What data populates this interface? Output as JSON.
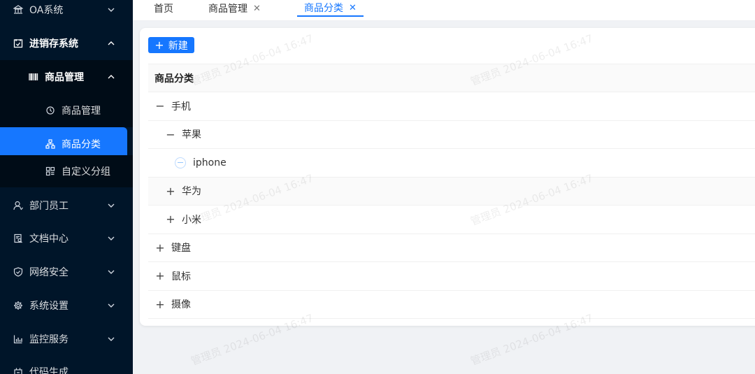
{
  "sidebar": {
    "items": [
      {
        "label": "OA系统",
        "icon": "bank-icon",
        "expanded": false
      },
      {
        "label": "进销存系统",
        "icon": "calendar-icon",
        "expanded": true
      },
      {
        "label": "商品管理",
        "icon": "barcode-icon",
        "expanded": true
      },
      {
        "label": "商品管理",
        "icon": "clock-icon"
      },
      {
        "label": "商品分类",
        "icon": "cluster-icon",
        "active": true
      },
      {
        "label": "自定义分组",
        "icon": "group-icon"
      },
      {
        "label": "部门员工",
        "icon": "user-icon",
        "expanded": false
      },
      {
        "label": "文档中心",
        "icon": "document-icon",
        "expanded": false
      },
      {
        "label": "网络安全",
        "icon": "shield-icon",
        "expanded": false
      },
      {
        "label": "系统设置",
        "icon": "gear-icon",
        "expanded": false
      },
      {
        "label": "监控服务",
        "icon": "bar-chart-icon",
        "expanded": false
      },
      {
        "label": "代码生成",
        "icon": "code-icon",
        "expanded": false
      }
    ]
  },
  "tabs": [
    {
      "label": "首页",
      "closable": false
    },
    {
      "label": "商品管理",
      "closable": true
    },
    {
      "label": "商品分类",
      "closable": true,
      "active": true
    }
  ],
  "toolbar": {
    "new_label": "新建"
  },
  "table": {
    "header": "商品分类",
    "rows": [
      {
        "label": "手机",
        "level": 0,
        "state": "expanded"
      },
      {
        "label": "苹果",
        "level": 1,
        "state": "expanded"
      },
      {
        "label": "iphone",
        "level": 2,
        "state": "leaf"
      },
      {
        "label": "华为",
        "level": 1,
        "state": "collapsed"
      },
      {
        "label": "小米",
        "level": 1,
        "state": "collapsed"
      },
      {
        "label": "键盘",
        "level": 0,
        "state": "collapsed"
      },
      {
        "label": "鼠标",
        "level": 0,
        "state": "collapsed"
      },
      {
        "label": "摄像",
        "level": 0,
        "state": "collapsed"
      }
    ]
  },
  "watermark": "管理员 2024-06-04 16:47",
  "colors": {
    "sidebar_bg": "#001529",
    "accent": "#1677ff"
  }
}
